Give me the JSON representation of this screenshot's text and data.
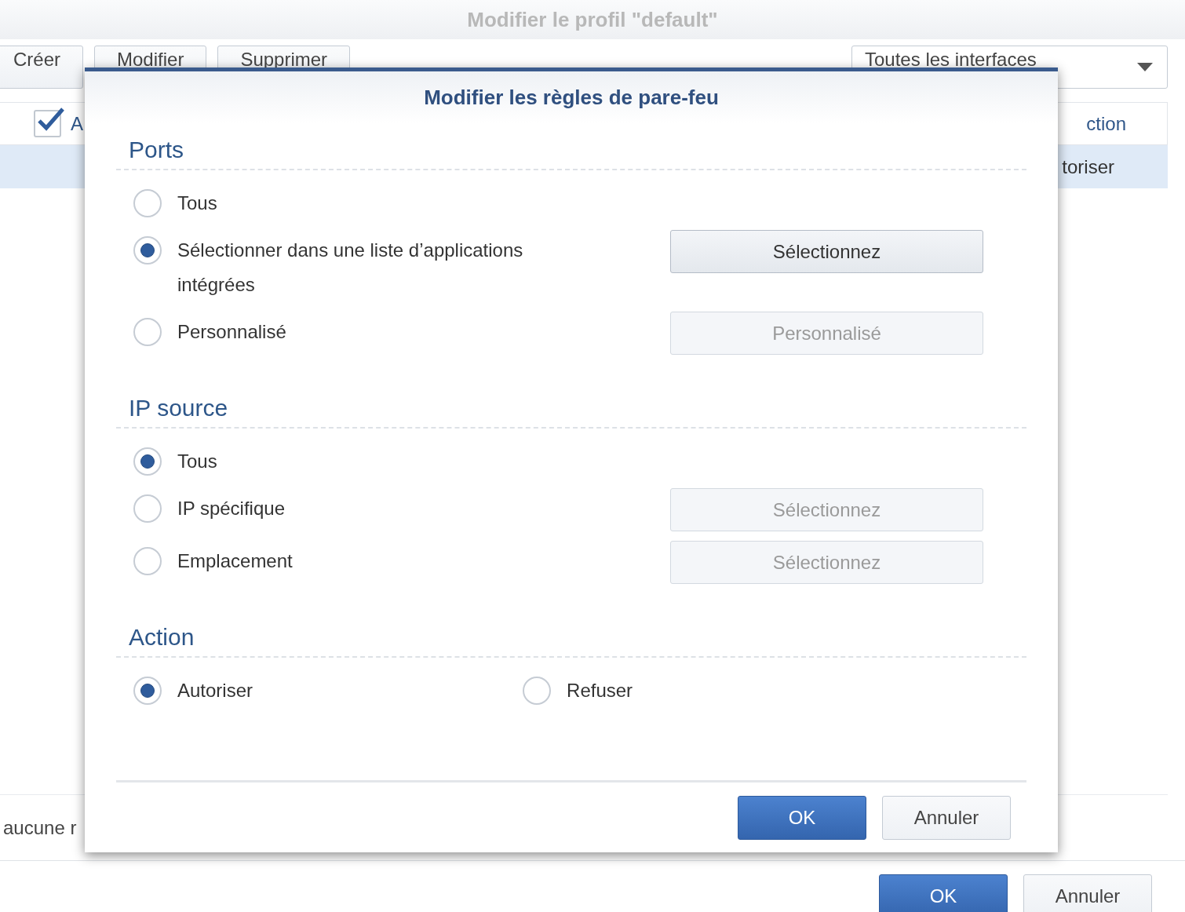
{
  "background": {
    "title": "Modifier le profil \"default\"",
    "toolbar": [
      {
        "label": "Créer"
      },
      {
        "label": "Modifier"
      },
      {
        "label": "Supprimer"
      }
    ],
    "interface_dropdown": {
      "value": "Toutes les interfaces"
    },
    "table": {
      "select_all_checked": true,
      "columns": [
        "A",
        "ction"
      ],
      "rows": [
        {
          "selected": true,
          "column_2": "toriser"
        }
      ]
    },
    "footer_text": "aucune r",
    "buttons": [
      {
        "label": "OK",
        "kind": "primary"
      },
      {
        "label": "Annuler",
        "kind": "secondary"
      }
    ]
  },
  "dialog": {
    "title": "Modifier les règles de pare-feu",
    "sections": [
      {
        "heading": "Ports",
        "kind": "list",
        "options": [
          {
            "label": "Tous",
            "selected": false
          },
          {
            "label": "Sélectionner dans une liste d’applications intégrées",
            "selected": true,
            "button": {
              "label": "Sélectionnez",
              "disabled": false
            }
          },
          {
            "label": "Personnalisé",
            "selected": false,
            "button": {
              "label": "Personnalisé",
              "disabled": true
            }
          }
        ]
      },
      {
        "heading": "IP source",
        "kind": "list",
        "options": [
          {
            "label": "Tous",
            "selected": true
          },
          {
            "label": "IP spécifique",
            "selected": false,
            "button": {
              "label": "Sélectionnez",
              "disabled": true
            }
          },
          {
            "label": "Emplacement",
            "selected": false,
            "button": {
              "label": "Sélectionnez",
              "disabled": true
            }
          }
        ]
      },
      {
        "heading": "Action",
        "kind": "inline",
        "options": [
          {
            "label": "Autoriser",
            "selected": true
          },
          {
            "label": "Refuser",
            "selected": false
          }
        ]
      }
    ],
    "buttons": [
      {
        "label": "OK",
        "kind": "primary"
      },
      {
        "label": "Annuler",
        "kind": "secondary"
      }
    ]
  }
}
